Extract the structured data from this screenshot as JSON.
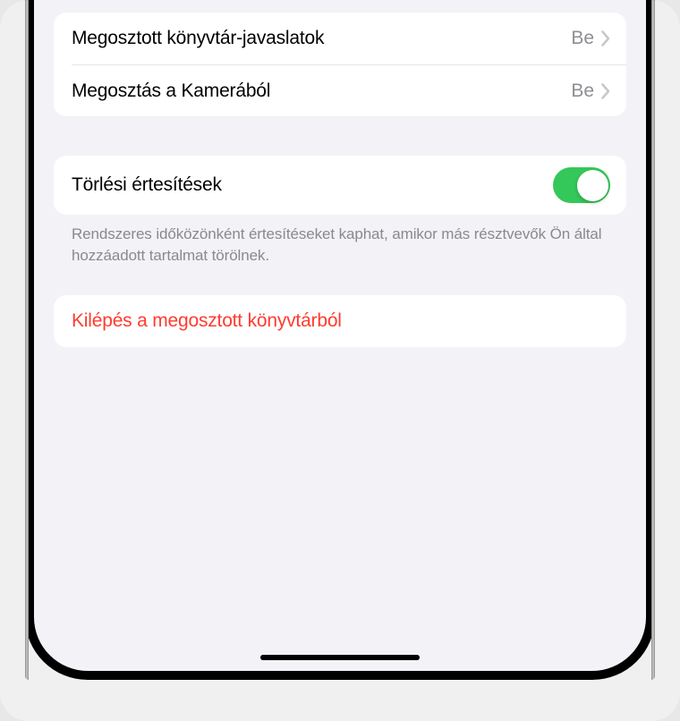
{
  "group1": {
    "rows": [
      {
        "label": "Megosztott könyvtár-javaslatok",
        "value": "Be"
      },
      {
        "label": "Megosztás a Kamerából",
        "value": "Be"
      }
    ]
  },
  "toggle": {
    "label": "Törlési értesítések",
    "on": true
  },
  "footer": "Rendszeres időközönként értesítéseket kaphat, amikor más résztvevők Ön által hozzáadott tartalmat törölnek.",
  "danger": {
    "label": "Kilépés a megosztott könyvtárból"
  },
  "colors": {
    "toggleOn": "#34c759",
    "danger": "#ff3b30",
    "secondaryText": "#8e8e93",
    "background": "#f2f2f7"
  }
}
